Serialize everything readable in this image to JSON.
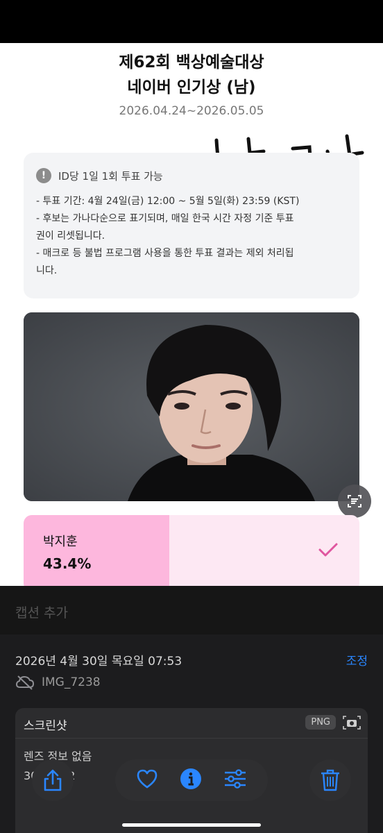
{
  "vote_page": {
    "title_line1": "제62회 백상예술대상",
    "title_line2": "네이버 인기상 (남)",
    "period": "2026.04.24~2026.05.05",
    "handwriting": "낮게서",
    "notice": {
      "heading": "ID당 1일 1회 투표 가능",
      "lines": [
        "- 투표 기간: 4월 24일(금) 12:00 ~ 5월 5일(화) 23:59 (KST)",
        "- 후보는 가나다순으로 표기되며, 매일 한국 시간 자정 기준 투표",
        "권이 리셋됩니다.",
        "- 매크로 등 불법 프로그램 사용을 통한 투표 결과는 제외 처리됩",
        "니다."
      ]
    },
    "candidate": {
      "name": "박지훈",
      "percent_label": "43.4%",
      "percent": 43.4
    }
  },
  "photos_info": {
    "caption_placeholder": "캡션 추가",
    "datetime": "2026년 4월 30일 목요일 07:53",
    "adjust_label": "조정",
    "filename": "IMG_7238",
    "meta": {
      "type_label": "스크린샷",
      "format_badge": "PNG",
      "lens_info": "렌즈 정보 없음",
      "dimensions": "3024 × 2"
    }
  },
  "icons": [
    "warning-icon",
    "live-text-icon",
    "checkmark-icon",
    "cloud-off-icon",
    "camera-icon",
    "share-icon",
    "heart-icon",
    "info-icon",
    "adjust-sliders-icon",
    "trash-icon"
  ],
  "colors": {
    "accent_blue": "#2a86ff",
    "vote_fill": "#fdb7dd",
    "vote_bg": "#fde8f3",
    "check_pink": "#e0569f"
  }
}
